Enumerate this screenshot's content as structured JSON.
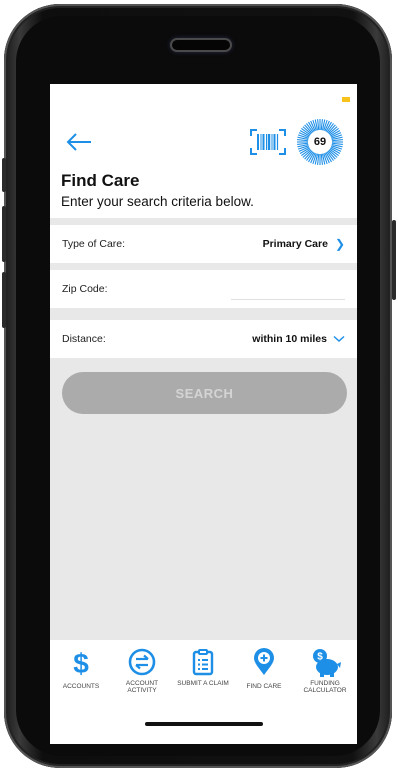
{
  "header": {
    "title": "Find Care",
    "subtitle": "Enter your search criteria below.",
    "badge_count": "69"
  },
  "form": {
    "type_of_care": {
      "label": "Type of Care:",
      "value": "Primary Care"
    },
    "zip_code": {
      "label": "Zip Code:",
      "value": "",
      "placeholder": ""
    },
    "distance": {
      "label": "Distance:",
      "value": "within 10 miles"
    },
    "search_label": "SEARCH"
  },
  "tabbar": {
    "items": [
      {
        "label": "ACCOUNTS",
        "icon": "dollar-icon"
      },
      {
        "label": "ACCOUNT ACTIVITY",
        "icon": "transfer-arrows-icon"
      },
      {
        "label": "SUBMIT A CLAIM",
        "icon": "clipboard-icon"
      },
      {
        "label": "FIND CARE",
        "icon": "map-pin-plus-icon"
      },
      {
        "label": "FUNDING CALCULATOR",
        "icon": "piggy-bank-icon"
      }
    ]
  },
  "colors": {
    "accent": "#1e8fe6",
    "status_dot": "#f6c21b",
    "search_disabled": "#ababab",
    "background": "#e8e8e8"
  }
}
